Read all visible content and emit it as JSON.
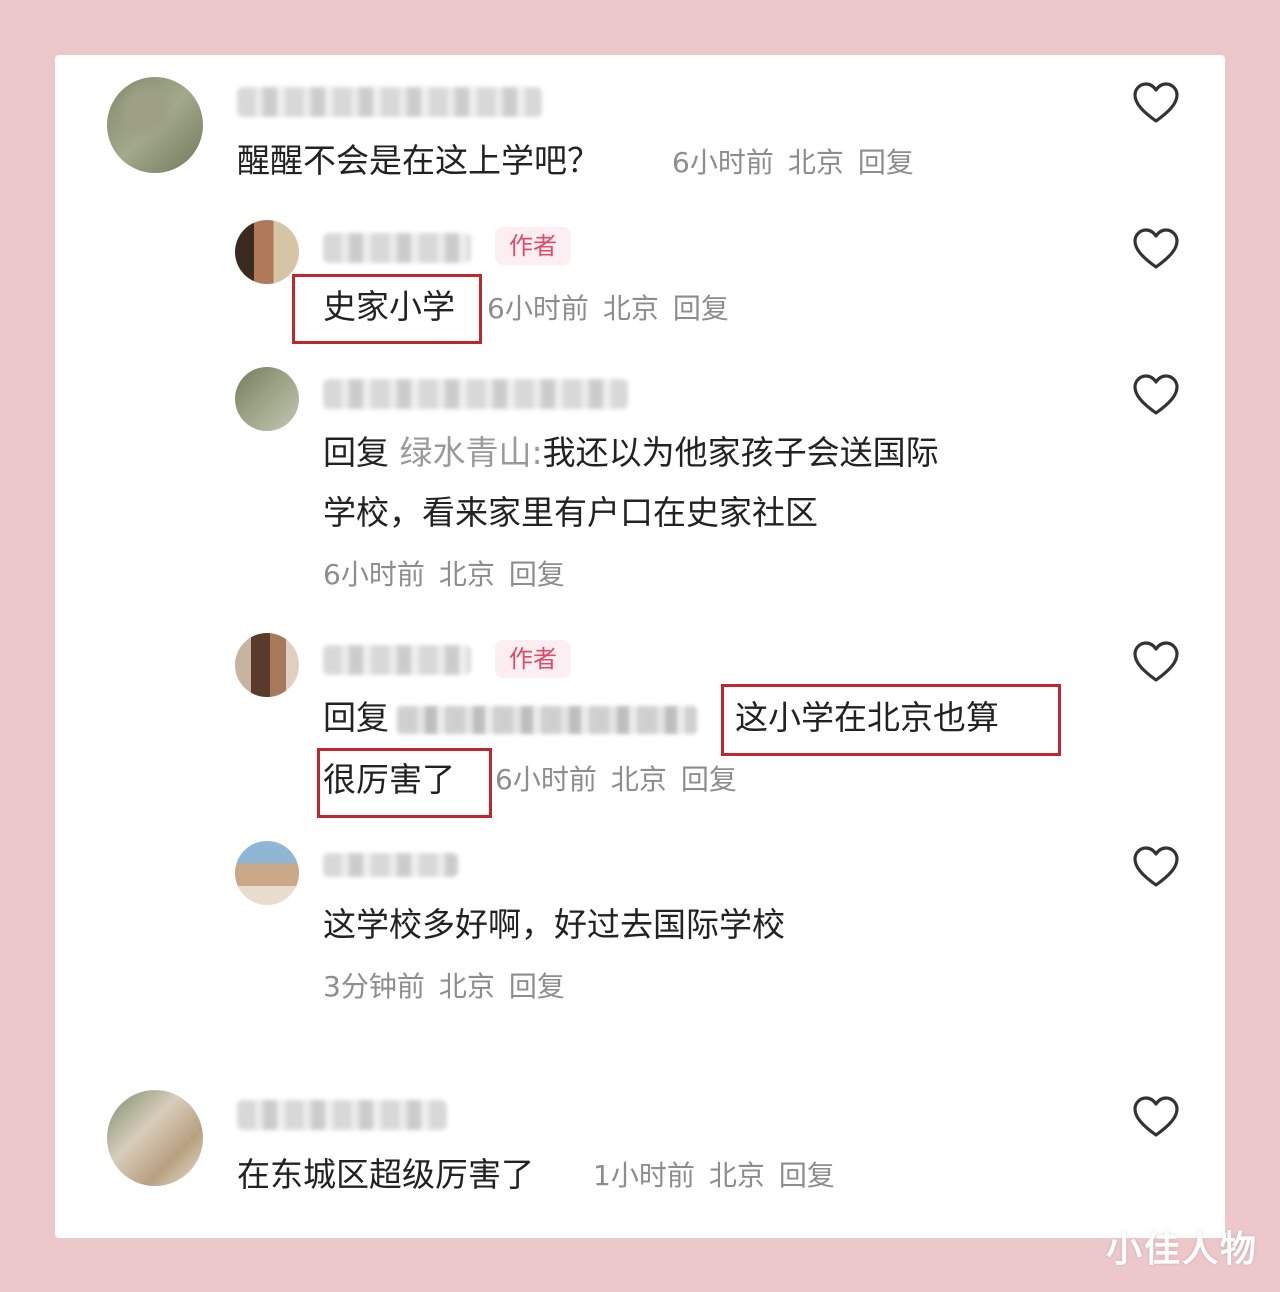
{
  "comments": [
    {
      "text": "醒醒不会是在这上学吧？",
      "time": "6小时前",
      "location": "北京",
      "reply_label": "回复"
    },
    {
      "author_badge": "作者",
      "text": "史家小学",
      "time": "6小时前",
      "location": "北京",
      "reply_label": "回复"
    },
    {
      "reply_prefix": "回复",
      "reply_to": "绿水青山:",
      "text_line1": "我还以为他家孩子会送国际",
      "text_line2": "学校，看来家里有户口在史家社区",
      "time": "6小时前",
      "location": "北京",
      "reply_label": "回复"
    },
    {
      "author_badge": "作者",
      "reply_prefix": "回复",
      "text_line1": "这小学在北京也算",
      "text_line2": "很厉害了",
      "time": "6小时前",
      "location": "北京",
      "reply_label": "回复"
    },
    {
      "text": "这学校多好啊，好过去国际学校",
      "time": "3分钟前",
      "location": "北京",
      "reply_label": "回复"
    },
    {
      "text": "在东城区超级厉害了",
      "time": "1小时前",
      "location": "北京",
      "reply_label": "回复"
    }
  ],
  "watermark": "小佳人物",
  "colors": {
    "highlight_box": "#c0262d",
    "author_badge": "#e04a6a",
    "frame": "#ecc8ca"
  }
}
